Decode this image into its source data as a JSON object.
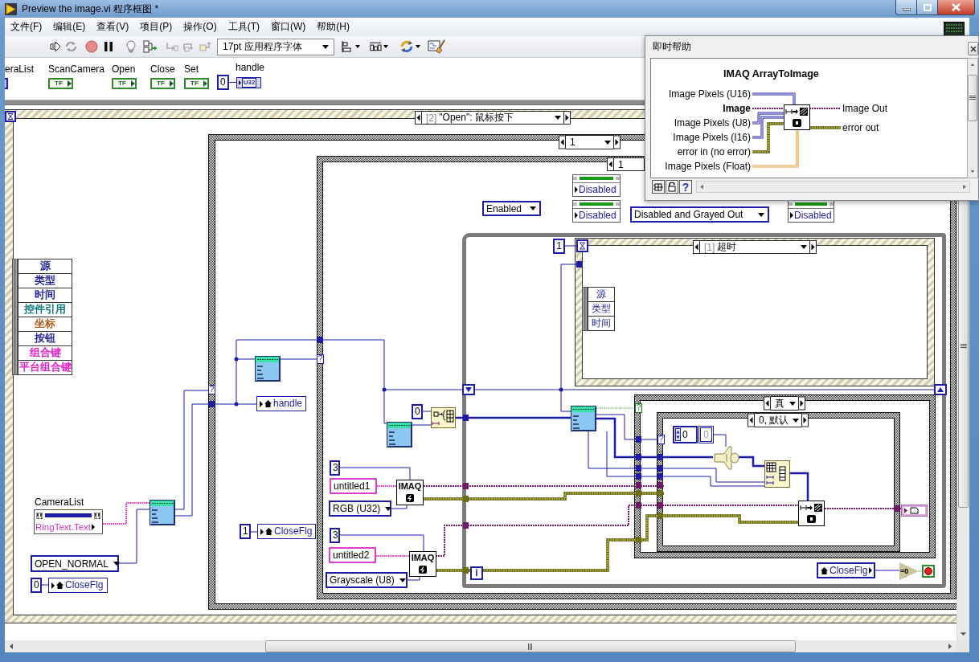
{
  "window": {
    "title": "Preview the image.vi 程序框图 *"
  },
  "menu": [
    "文件(F)",
    "编辑(E)",
    "查看(V)",
    "项目(P)",
    "操作(O)",
    "工具(T)",
    "窗口(W)",
    "帮助(H)"
  ],
  "toolbar": {
    "font": "17pt 应用程序字体"
  },
  "terminals": [
    {
      "label": "eraList",
      "kind": "cluster"
    },
    {
      "label": "ScanCamera",
      "kind": "boolean",
      "type": "TF"
    },
    {
      "label": "Open",
      "kind": "boolean",
      "type": "TF"
    },
    {
      "label": "Close",
      "kind": "boolean",
      "type": "TF"
    },
    {
      "label": "Set",
      "kind": "boolean",
      "type": "TF"
    },
    {
      "label": "handle",
      "kind": "numeric",
      "type": "U32",
      "constant": "0"
    }
  ],
  "event_structure": {
    "selector": {
      "index": "[2]",
      "event": "\"Open\": 鼠标按下"
    },
    "event_data": [
      {
        "label": "源",
        "color": "#1f1f9c"
      },
      {
        "label": "类型",
        "color": "#1f1f9c"
      },
      {
        "label": "时间",
        "color": "#1f1f9c"
      },
      {
        "label": "控件引用",
        "color": "#0a7a7a"
      },
      {
        "label": "坐标",
        "color": "#b0601c"
      },
      {
        "label": "按钮",
        "color": "#1f1f9c"
      },
      {
        "label": "组合键",
        "color": "#e020c8"
      },
      {
        "label": "平台组合键",
        "color": "#e020c8"
      }
    ],
    "camera_list": {
      "label": "CameraList",
      "value": "RingText.Text"
    },
    "open_mode": "OPEN_NORMAL",
    "close_flag_reset": {
      "constant": "0",
      "variable": "CloseFlg"
    },
    "case_structure": {
      "selector": "1",
      "terminal": "?",
      "handle_variable": "handle",
      "close_flag_set": {
        "constant": "1",
        "variable": "CloseFlg"
      },
      "inner_case": {
        "selector": "1",
        "terminal": "?",
        "enable_state": "Enabled",
        "property_nodes": [
          "Disabled",
          "Disabled"
        ],
        "disable_state": "Disabled and Grayed Out",
        "disable_property": "Disabled",
        "index_constant": "0",
        "image_create": [
          {
            "size": "3",
            "name": "untitled1",
            "type": "RGB (U32)",
            "label": "IMAQ"
          },
          {
            "size": "3",
            "name": "untitled2",
            "type": "Grayscale (U8)",
            "label": "IMAQ"
          }
        ],
        "while_loop": {
          "timeout": "1",
          "timeout_event": {
            "index": "[1]",
            "event": "超时",
            "event_data": [
              "源",
              "类型",
              "时间"
            ]
          },
          "true_case": {
            "selector": "真",
            "terminal": "?",
            "default_case": {
              "selector": "0, 默认",
              "terminal": "?",
              "control": "0",
              "indicator": "0"
            }
          },
          "close_flag_read": "CloseFlg",
          "compare": "=0",
          "iteration": "i"
        }
      }
    }
  },
  "context_help": {
    "title": "即时帮助",
    "function": "IMAQ ArrayToImage",
    "inputs": [
      {
        "label": "Image Pixels (U16)",
        "required": false
      },
      {
        "label": "Image",
        "required": true
      },
      {
        "label": "Image Pixels (U8)",
        "required": false
      },
      {
        "label": "Image Pixels (I16)",
        "required": false
      },
      {
        "label": "error in (no error)",
        "required": false
      },
      {
        "label": "Image Pixels (Float)",
        "required": false
      }
    ],
    "outputs": [
      "Image Out",
      "error out"
    ],
    "help_button": "?"
  }
}
